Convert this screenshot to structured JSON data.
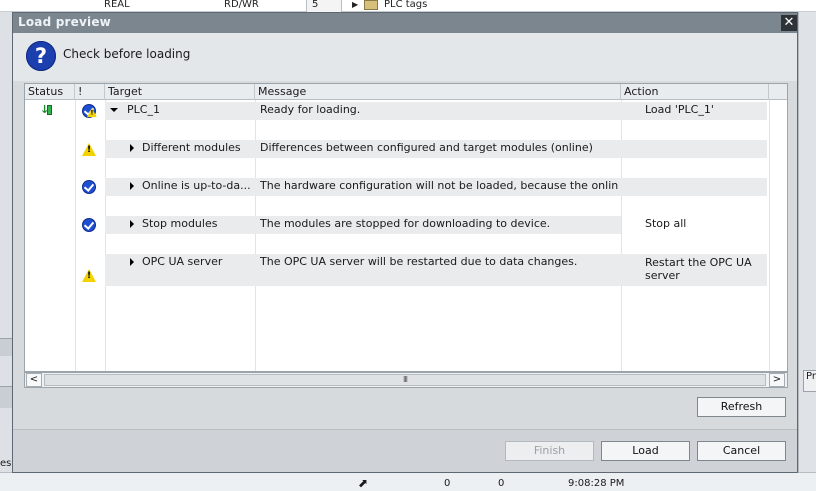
{
  "background": {
    "top_values": [
      "REAL",
      "RD/WR",
      "5",
      "PLC tags"
    ],
    "left_fragment": "es",
    "right_fragment": "Pr",
    "status_values": [
      "0",
      "0",
      "9:08:28 PM"
    ]
  },
  "dialog": {
    "title": "Load preview",
    "header_text": "Check before loading",
    "close_label": "✕"
  },
  "table": {
    "columns": [
      "Status",
      "!",
      "Target",
      "Message",
      "Action"
    ],
    "rows": [
      {
        "target": "PLC_1",
        "message": "Ready for loading.",
        "action": "Load 'PLC_1'"
      },
      {
        "target": "Different modules",
        "message": "Differences between configured and target modules (online)",
        "action": ""
      },
      {
        "target": "Online is up-to-da...",
        "message": "The hardware configuration will not be loaded, because the onlin...",
        "action": ""
      },
      {
        "target": "Stop modules",
        "message": "The modules are stopped for downloading to device.",
        "action": "Stop all"
      },
      {
        "target": "OPC UA server",
        "message": "The OPC UA server will be restarted due to data changes.",
        "action": "Restart the OPC UA server"
      }
    ]
  },
  "scroll": {
    "thumb_grip": "III"
  },
  "buttons": {
    "refresh": "Refresh",
    "finish": "Finish",
    "load": "Load",
    "cancel": "Cancel"
  },
  "icons": {
    "help": "?",
    "scroll_left": "<",
    "scroll_right": ">"
  },
  "colors": {
    "titlebar": "#7b868f",
    "help_icon": "#1b3fae",
    "check_icon": "#1f4fd1",
    "warning_icon": "#f2d200"
  }
}
